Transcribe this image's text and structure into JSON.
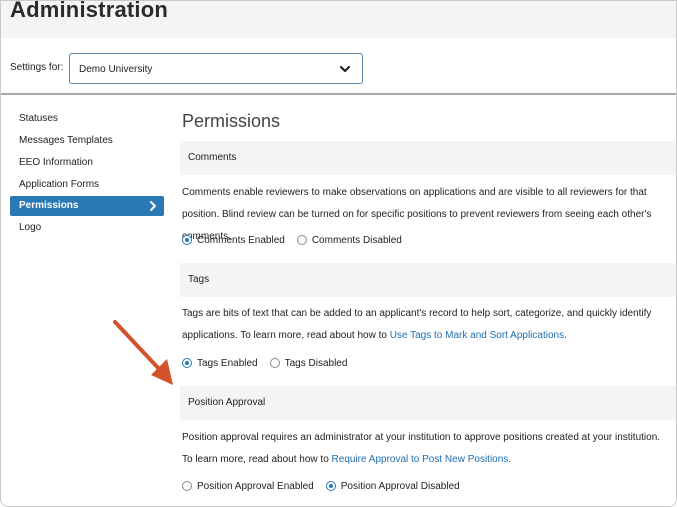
{
  "header": {
    "title": "Administration"
  },
  "settings": {
    "label": "Settings for:",
    "selected": "Demo University"
  },
  "sidebar": {
    "items": [
      {
        "label": "Statuses"
      },
      {
        "label": "Messages Templates"
      },
      {
        "label": "EEO Information"
      },
      {
        "label": "Application Forms"
      },
      {
        "label": "Permissions",
        "active": true
      },
      {
        "label": "Logo"
      }
    ]
  },
  "main": {
    "title": "Permissions",
    "comments": {
      "heading": "Comments",
      "description": "Comments enable reviewers to make observations on applications and are visible to all reviewers for that position. Blind review can be turned on for specific positions to prevent reviewers from seeing each other's comments.",
      "option_enabled": "Comments Enabled",
      "option_disabled": "Comments Disabled",
      "selected": "enabled"
    },
    "tags": {
      "heading": "Tags",
      "description_pre": "Tags are bits of text that can be added to an applicant's record to help sort, categorize, and quickly identify applications. To learn more, read about how to ",
      "link": "Use Tags to Mark and Sort Applications.",
      "option_enabled": "Tags Enabled",
      "option_disabled": "Tags Disabled",
      "selected": "enabled"
    },
    "position_approval": {
      "heading": "Position Approval",
      "description_pre": "Position approval requires an administrator at your institution to approve positions created at your institution. To learn more, read about how to ",
      "link": "Require Approval to Post New Positions.",
      "option_enabled": "Position Approval Enabled",
      "option_disabled": "Position Approval Disabled",
      "selected": "disabled"
    }
  },
  "colors": {
    "accent": "#2a79b5",
    "annotation_arrow": "#d2522a",
    "link": "#1f6fb1"
  }
}
